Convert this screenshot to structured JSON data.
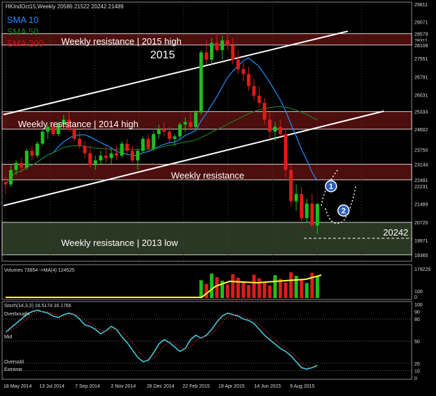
{
  "header": {
    "title": "HKIndOct15,Weekly  20586 21522 20242 21489"
  },
  "legend": [
    {
      "label": "SMA 10",
      "color": "#1e90ff"
    },
    {
      "label": "SMA 50",
      "color": "#1f7a1f"
    },
    {
      "label": "SMA 200",
      "color": "#cc1111"
    }
  ],
  "annotations": {
    "year_label": "2015",
    "zone_2015_high": "Weekly resistance | 2015 high",
    "zone_2014_high": "Weekly resistance | 2014 high",
    "zone_weekly": "Weekly resistance",
    "zone_2013_low": "Weekly resistance | 2013 low",
    "current_level": "20242",
    "marker_1": "1",
    "marker_2": "2"
  },
  "colors": {
    "bull": "#1fbf1f",
    "bear": "#e01a1a",
    "resistance_zone": "#5a1010",
    "support_zone": "#2f3d27",
    "stoch_main": "#3fb7c6",
    "stoch_signal": "#c02020",
    "volume_ma": "#ffff33"
  },
  "price_axis": {
    "ticks": [
      "29811",
      "29071",
      "28579",
      "28311",
      "28108",
      "27551",
      "26791",
      "26031",
      "25333",
      "24602",
      "23750",
      "23144",
      "22491",
      "22231",
      "21489",
      "20720",
      "19971",
      "19365"
    ]
  },
  "volume_panel": {
    "label": "Volumes 73854  ->MA(4) 124525",
    "ticks": [
      "179225",
      "100",
      "0"
    ]
  },
  "stoch_panel": {
    "label": "Stoch(14,3,3) 18.5174 16.1766",
    "level_labels": [
      "Overbought",
      "Mid",
      "Oversold",
      "Extreme"
    ],
    "ticks": [
      "100",
      "90",
      "80",
      "50",
      "20",
      "10",
      "0"
    ]
  },
  "time_axis": {
    "labels": [
      "18 May 2014",
      "13 Jul 2014",
      "7 Sep 2014",
      "2 Nov 2014",
      "28 Dec 2014",
      "22 Feb 2015",
      "19 Apr 2015",
      "14 Jun 2015",
      "9 Aug 2015"
    ]
  },
  "chart_data": {
    "type": "candlestick",
    "symbol": "HKIndOct15",
    "timeframe": "Weekly",
    "last_bar": {
      "open": 20586,
      "high": 21522,
      "low": 20242,
      "close": 21489
    },
    "candles": [
      [
        22400,
        22600,
        21900,
        22300
      ],
      [
        22300,
        23100,
        22200,
        22900
      ],
      [
        22900,
        23300,
        22700,
        23200
      ],
      [
        23200,
        23400,
        22800,
        23000
      ],
      [
        23000,
        23800,
        22900,
        23700
      ],
      [
        23700,
        23900,
        23300,
        23500
      ],
      [
        23500,
        24100,
        23400,
        24000
      ],
      [
        24000,
        24600,
        23900,
        24500
      ],
      [
        24500,
        24800,
        24200,
        24700
      ],
      [
        24700,
        24900,
        24300,
        24400
      ],
      [
        24400,
        24900,
        24300,
        24800
      ],
      [
        24800,
        25200,
        24600,
        25000
      ],
      [
        25000,
        25300,
        24500,
        24600
      ],
      [
        24600,
        24800,
        24100,
        24200
      ],
      [
        24200,
        24500,
        23800,
        23900
      ],
      [
        23900,
        24100,
        23400,
        23600
      ],
      [
        23600,
        23900,
        23000,
        23100
      ],
      [
        23100,
        23500,
        22900,
        23300
      ],
      [
        23300,
        23700,
        23100,
        23500
      ],
      [
        23500,
        23900,
        23200,
        23400
      ],
      [
        23400,
        23800,
        23100,
        23600
      ],
      [
        23600,
        23900,
        23300,
        23500
      ],
      [
        23500,
        24100,
        23400,
        24000
      ],
      [
        24000,
        24200,
        23500,
        23700
      ],
      [
        23700,
        23900,
        23200,
        23300
      ],
      [
        23300,
        23800,
        22900,
        23700
      ],
      [
        23700,
        24300,
        23600,
        24200
      ],
      [
        24200,
        24400,
        23700,
        23800
      ],
      [
        23800,
        24500,
        23700,
        24400
      ],
      [
        24400,
        24800,
        24200,
        24600
      ],
      [
        24600,
        24900,
        24300,
        24500
      ],
      [
        24500,
        24700,
        24000,
        24200
      ],
      [
        24200,
        24400,
        23900,
        24300
      ],
      [
        24300,
        24900,
        24200,
        24800
      ],
      [
        24800,
        25100,
        24500,
        24900
      ],
      [
        24900,
        25300,
        24600,
        24700
      ],
      [
        24700,
        25400,
        24600,
        25300
      ],
      [
        25300,
        27900,
        25200,
        27800
      ],
      [
        27800,
        28300,
        27300,
        27500
      ],
      [
        27500,
        28400,
        27300,
        28200
      ],
      [
        28200,
        28600,
        27800,
        27900
      ],
      [
        27900,
        28500,
        27500,
        28300
      ],
      [
        28300,
        28600,
        27900,
        28100
      ],
      [
        28100,
        28400,
        27300,
        27500
      ],
      [
        27500,
        27900,
        26900,
        27100
      ],
      [
        27100,
        27400,
        26600,
        26900
      ],
      [
        26900,
        27200,
        26200,
        26400
      ],
      [
        26400,
        26700,
        25800,
        26000
      ],
      [
        26000,
        26400,
        25500,
        25700
      ],
      [
        25700,
        25900,
        24800,
        25000
      ],
      [
        25000,
        25300,
        24200,
        24500
      ],
      [
        24500,
        24900,
        24100,
        24700
      ],
      [
        24700,
        25000,
        24300,
        24400
      ],
      [
        24400,
        24600,
        22600,
        22900
      ],
      [
        22900,
        23200,
        21400,
        21600
      ],
      [
        21600,
        22300,
        21200,
        21900
      ],
      [
        21900,
        22200,
        20600,
        20900
      ],
      [
        20900,
        21700,
        20700,
        21500
      ],
      [
        21500,
        21900,
        20500,
        20600
      ],
      [
        20586,
        21522,
        20242,
        21489
      ]
    ],
    "resistance_zones": [
      {
        "label": "Weekly resistance | 2015 high",
        "from": 28108,
        "to": 28579
      },
      {
        "label": "Weekly resistance | 2014 high",
        "from": 24602,
        "to": 25333
      },
      {
        "label": "Weekly resistance",
        "from": 22491,
        "to": 23144
      },
      {
        "label": "Weekly resistance | 2013 low",
        "from": 19365,
        "to": 20720
      }
    ],
    "price_range": [
      19100,
      29811
    ],
    "volume_max": 179225,
    "stoch_current": {
      "main": 18.5174,
      "signal": 16.1766
    },
    "stoch_levels": {
      "overbought": 80,
      "mid": 50,
      "oversold": 20,
      "extreme": 10
    }
  }
}
